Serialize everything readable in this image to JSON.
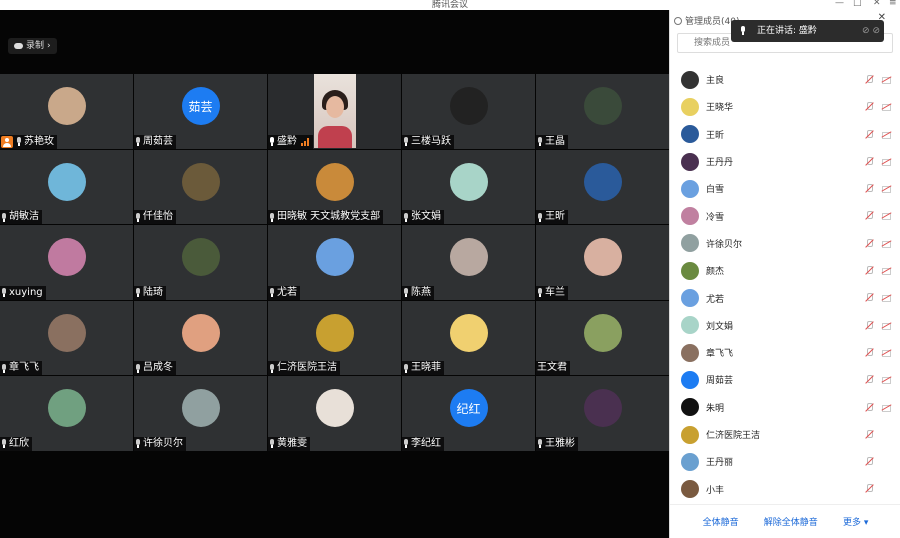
{
  "window": {
    "title": "腾讯会议"
  },
  "recording": {
    "label": "录制"
  },
  "speaking_toast": {
    "text": "正在讲话: 盛黔"
  },
  "sidebar": {
    "title": "管理成员(40)",
    "search_placeholder": "搜索成员",
    "footer": {
      "mute_all": "全体静音",
      "unmute_all": "解除全体静音",
      "more": "更多 ▾"
    }
  },
  "tiles": [
    {
      "name": "苏艳玫",
      "host": true,
      "avatar_color": "#c9a88a"
    },
    {
      "name": "周茹芸",
      "avatar_text": "茹芸",
      "avatar_color": "#1d7cf2"
    },
    {
      "name": "盛黔",
      "video": true,
      "mic_active": true
    },
    {
      "name": "三楼马跃",
      "avatar_color": "#222222"
    },
    {
      "name": "王晶",
      "avatar_color": "#3a4a3a"
    },
    {
      "name": "胡敏洁",
      "avatar_color": "#6fb6d9"
    },
    {
      "name": "仟佳怡",
      "avatar_color": "#6b5a3a"
    },
    {
      "name": "田晓敏 天文城教党支部",
      "avatar_color": "#c98a3a"
    },
    {
      "name": "张文娟",
      "avatar_color": "#a8d4c8"
    },
    {
      "name": "王昕",
      "avatar_color": "#2a5a9a"
    },
    {
      "name": "xuying",
      "avatar_color": "#c07aa0"
    },
    {
      "name": "陆琦",
      "avatar_color": "#4a5a3a"
    },
    {
      "name": "尤若",
      "avatar_color": "#6aa0e0"
    },
    {
      "name": "陈燕",
      "avatar_color": "#b8a8a0"
    },
    {
      "name": "车兰",
      "avatar_color": "#d8b0a0"
    },
    {
      "name": "章飞飞",
      "avatar_color": "#8a7060"
    },
    {
      "name": "吕成冬",
      "avatar_color": "#e0a080"
    },
    {
      "name": "仁济医院王洁",
      "avatar_color": "#c8a030"
    },
    {
      "name": "王晓菲",
      "avatar_color": "#f0d070"
    },
    {
      "name": "王文君",
      "avatar_color": "#8aa060",
      "no_mic": true
    },
    {
      "name": "红欣",
      "avatar_color": "#70a080"
    },
    {
      "name": "许徐贝尔",
      "avatar_color": "#90a0a0"
    },
    {
      "name": "黄雅雯",
      "avatar_color": "#e8e0d8"
    },
    {
      "name": "李纪红",
      "avatar_text": "纪红",
      "avatar_color": "#1d7cf2"
    },
    {
      "name": "王雅彬",
      "avatar_color": "#4a3050"
    }
  ],
  "participants": [
    {
      "name": "主良",
      "color": "#333333"
    },
    {
      "name": "王晓华",
      "color": "#e8d060"
    },
    {
      "name": "王昕",
      "color": "#2a5a9a"
    },
    {
      "name": "王丹丹",
      "color": "#4a3050"
    },
    {
      "name": "白雪",
      "color": "#6aa0e0"
    },
    {
      "name": "冷雪",
      "color": "#c080a0"
    },
    {
      "name": "许徐贝尔",
      "color": "#90a0a0"
    },
    {
      "name": "颜杰",
      "color": "#6a8a40"
    },
    {
      "name": "尤若",
      "color": "#6aa0e0"
    },
    {
      "name": "刘文娟",
      "color": "#a8d4c8"
    },
    {
      "name": "章飞飞",
      "color": "#8a7060"
    },
    {
      "name": "周茹芸",
      "color": "#1d7cf2"
    },
    {
      "name": "朱明",
      "color": "#111111"
    },
    {
      "name": "仁济医院王洁",
      "color": "#c8a030"
    },
    {
      "name": "王丹丽",
      "color": "#6aa0d0"
    },
    {
      "name": "小丰",
      "color": "#7a5a40"
    }
  ]
}
